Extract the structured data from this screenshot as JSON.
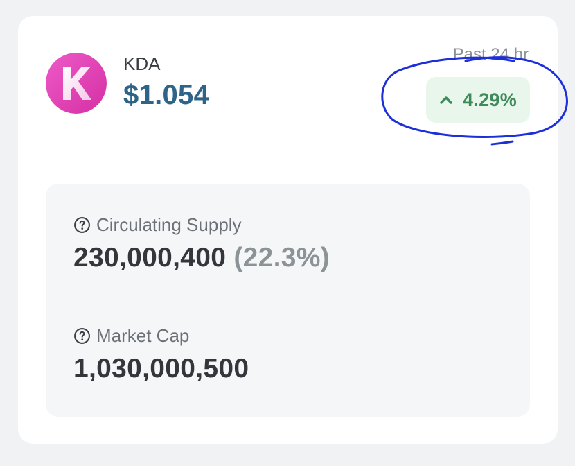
{
  "token": {
    "symbol": "KDA",
    "logo_letter": "K",
    "price": "$1.054"
  },
  "change": {
    "period_label": "Past 24 hr",
    "value": "4.29%",
    "direction_icon": "chevron-up-icon",
    "color": "#3f8a5b"
  },
  "stats": {
    "circulating_supply": {
      "label": "Circulating Supply",
      "value": "230,000,400",
      "percent": "(22.3%)"
    },
    "market_cap": {
      "label": "Market Cap",
      "value": "1,030,000,500"
    }
  },
  "colors": {
    "price": "#2e6487",
    "logo": "#e040b0",
    "annotation": "#1c2fd8"
  }
}
